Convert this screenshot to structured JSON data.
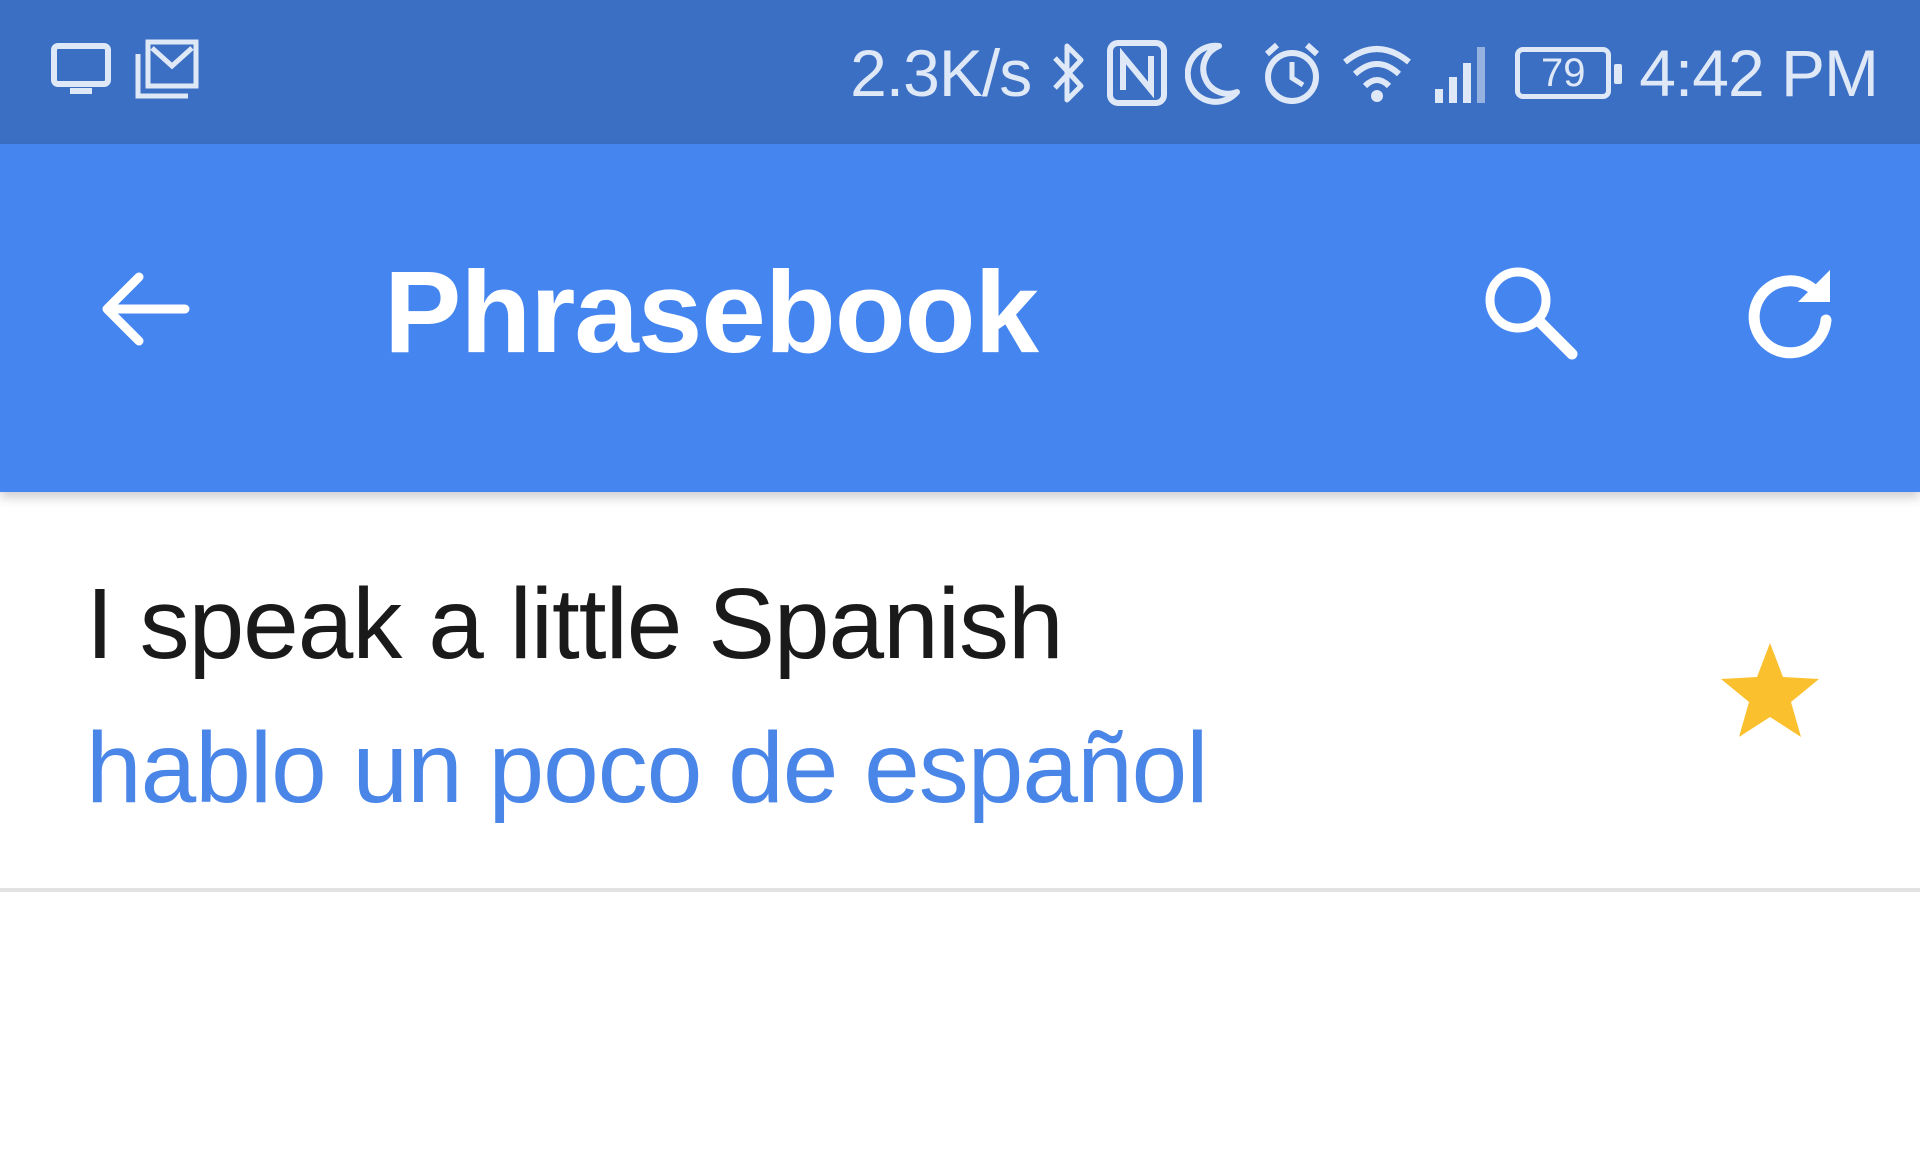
{
  "status_bar": {
    "left_icons": [
      "screen-cast-icon",
      "gmail-notification-icon"
    ],
    "network_speed": "2.3K/s",
    "right_icons": [
      "bluetooth-icon",
      "nfc-icon",
      "do-not-disturb-moon-icon",
      "alarm-clock-icon",
      "wifi-icon",
      "cell-signal-icon"
    ],
    "battery_level": "79",
    "time": "4:42 PM"
  },
  "app_bar": {
    "title": "Phrasebook",
    "back_icon": "arrow-back-icon",
    "search_icon": "search-icon",
    "refresh_icon": "refresh-icon"
  },
  "phrases": [
    {
      "source": "I speak a little Spanish",
      "translation": "hablo un poco de español",
      "starred": true,
      "star_icon": "star-icon"
    }
  ],
  "colors": {
    "status_bar": "#3a6fc4",
    "app_bar": "#4585f0",
    "translation_text": "#4a86e8",
    "star": "#fbc02d",
    "divider": "#e2e2e2"
  }
}
